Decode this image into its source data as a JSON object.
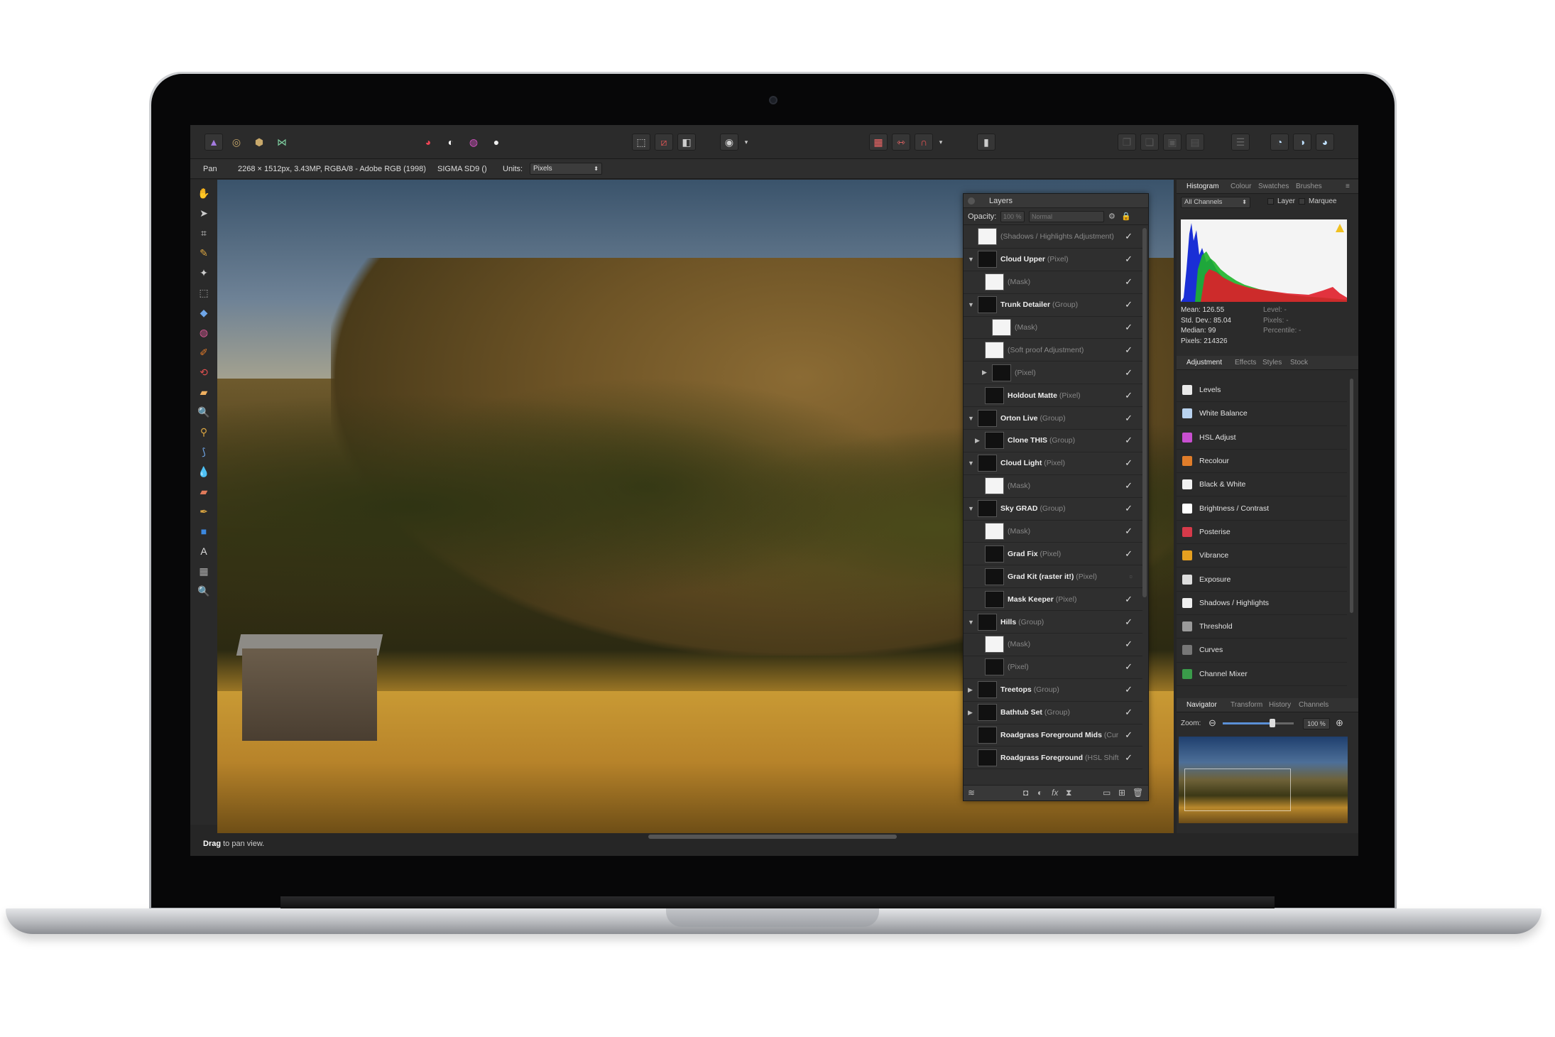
{
  "toolbar": {
    "persona_icons": [
      "photo-persona-icon",
      "liquify-persona-icon",
      "develop-persona-icon",
      "export-persona-icon"
    ],
    "adjust_icons": [
      "auto-levels-icon",
      "auto-contrast-icon",
      "auto-colour-icon",
      "auto-white-balance-icon"
    ],
    "selection_icons": [
      "marquee-icon",
      "deselect-icon",
      "invert-selection-icon"
    ],
    "mask_icon": "quick-mask-icon",
    "snap_icons": [
      "grid-icon",
      "mirror-icon",
      "snapping-icon"
    ],
    "assistant_icon": "assistant-icon",
    "arrange_icons": [
      "arrange-forward-icon",
      "arrange-back-icon",
      "arrange-front-icon",
      "arrange-rear-icon"
    ],
    "align_icon": "align-icon",
    "studio_icons": [
      "studio-1-icon",
      "studio-2-icon",
      "studio-3-icon"
    ]
  },
  "context": {
    "tool_name": "Pan",
    "document_info": "2268 × 1512px, 3.43MP, RGBA/8 - Adobe RGB (1998)",
    "camera": "SIGMA SD9 ()",
    "units_label": "Units:",
    "units_value": "Pixels"
  },
  "status": {
    "bold": "Drag",
    "rest": " to pan view."
  },
  "layers_panel": {
    "title": "Layers",
    "opacity_label": "Opacity:",
    "opacity_value": "100 %",
    "blend_mode": "Normal",
    "items": [
      {
        "name": "",
        "type": "(Shadows / Highlights Adjustment)",
        "arrow": "",
        "indent": 0,
        "visible": true
      },
      {
        "name": "Cloud Upper",
        "type": "(Pixel)",
        "arrow": "▼",
        "indent": 0,
        "visible": true
      },
      {
        "name": "",
        "type": "(Mask)",
        "arrow": "",
        "indent": 1,
        "visible": true
      },
      {
        "name": "Trunk Detailer",
        "type": "(Group)",
        "arrow": "▼",
        "indent": 0,
        "visible": true
      },
      {
        "name": "",
        "type": "(Mask)",
        "arrow": "",
        "indent": 2,
        "visible": true
      },
      {
        "name": "",
        "type": "(Soft proof Adjustment)",
        "arrow": "",
        "indent": 1,
        "visible": true
      },
      {
        "name": "",
        "type": "(Pixel)",
        "arrow": "▶",
        "indent": 2,
        "visible": true
      },
      {
        "name": "Holdout Matte",
        "type": "(Pixel)",
        "arrow": "",
        "indent": 1,
        "visible": true
      },
      {
        "name": "Orton Live",
        "type": "(Group)",
        "arrow": "▼",
        "indent": 0,
        "visible": true
      },
      {
        "name": "Clone THIS",
        "type": "(Group)",
        "arrow": "▶",
        "indent": 1,
        "visible": true
      },
      {
        "name": "Cloud Light",
        "type": "(Pixel)",
        "arrow": "▼",
        "indent": 0,
        "visible": true
      },
      {
        "name": "",
        "type": "(Mask)",
        "arrow": "",
        "indent": 1,
        "visible": true
      },
      {
        "name": "Sky GRAD",
        "type": "(Group)",
        "arrow": "▼",
        "indent": 0,
        "visible": true
      },
      {
        "name": "",
        "type": "(Mask)",
        "arrow": "",
        "indent": 1,
        "visible": true
      },
      {
        "name": "Grad Fix",
        "type": "(Pixel)",
        "arrow": "",
        "indent": 1,
        "visible": true
      },
      {
        "name": "Grad Kit (raster it!)",
        "type": "(Pixel)",
        "arrow": "",
        "indent": 1,
        "visible": false
      },
      {
        "name": "Mask Keeper",
        "type": "(Pixel)",
        "arrow": "",
        "indent": 1,
        "visible": true
      },
      {
        "name": "Hills",
        "type": "(Group)",
        "arrow": "▼",
        "indent": 0,
        "visible": true
      },
      {
        "name": "",
        "type": "(Mask)",
        "arrow": "",
        "indent": 1,
        "visible": true
      },
      {
        "name": "",
        "type": "(Pixel)",
        "arrow": "",
        "indent": 1,
        "visible": true
      },
      {
        "name": "Treetops",
        "type": "(Group)",
        "arrow": "▶",
        "indent": 0,
        "visible": true
      },
      {
        "name": "Bathtub Set",
        "type": "(Group)",
        "arrow": "▶",
        "indent": 0,
        "visible": true
      },
      {
        "name": "Roadgrass Foreground Mids",
        "type": "(Cur",
        "arrow": "",
        "indent": 0,
        "visible": true
      },
      {
        "name": "Roadgrass Foreground",
        "type": "(HSL Shift",
        "arrow": "",
        "indent": 0,
        "visible": true
      }
    ],
    "footer_icons": [
      "layers-stack-icon",
      "mask-layer-icon",
      "adjustment-icon",
      "fx-icon",
      "live-filter-icon",
      "group-folder-icon",
      "add-layer-icon",
      "delete-layer-icon"
    ],
    "fx_label": "fx"
  },
  "right_panel": {
    "top_tabs": [
      "Histogram",
      "Colour",
      "Swatches",
      "Brushes"
    ],
    "channels_value": "All Channels",
    "layer_label": "Layer",
    "marquee_label": "Marquee",
    "stats": {
      "mean": "Mean: 126.55",
      "std": "Std. Dev.: 85.04",
      "median": "Median: 99",
      "pixels": "Pixels: 214326",
      "level": "Level: -",
      "pixels2": "Pixels: -",
      "percentile": "Percentile: -"
    },
    "mid_tabs": [
      "Adjustment",
      "Effects",
      "Styles",
      "Stock"
    ],
    "adjustments": [
      {
        "label": "Levels",
        "color": "#e9e9e9"
      },
      {
        "label": "White Balance",
        "color": "#b9d3ef"
      },
      {
        "label": "HSL Adjust",
        "color": "#c84fd0"
      },
      {
        "label": "Recolour",
        "color": "#e07d2a"
      },
      {
        "label": "Black & White",
        "color": "#f0f0f0"
      },
      {
        "label": "Brightness / Contrast",
        "color": "#ffffff"
      },
      {
        "label": "Posterise",
        "color": "#d63a4a"
      },
      {
        "label": "Vibrance",
        "color": "#e6a020"
      },
      {
        "label": "Exposure",
        "color": "#dddddd"
      },
      {
        "label": "Shadows / Highlights",
        "color": "#efefef"
      },
      {
        "label": "Threshold",
        "color": "#9a9a9a"
      },
      {
        "label": "Curves",
        "color": "#777777"
      },
      {
        "label": "Channel Mixer",
        "color": "#3a9b4a"
      }
    ],
    "bottom_tabs": [
      "Navigator",
      "Transform",
      "History",
      "Channels"
    ],
    "zoom_label": "Zoom:",
    "zoom_value": "100 %"
  }
}
